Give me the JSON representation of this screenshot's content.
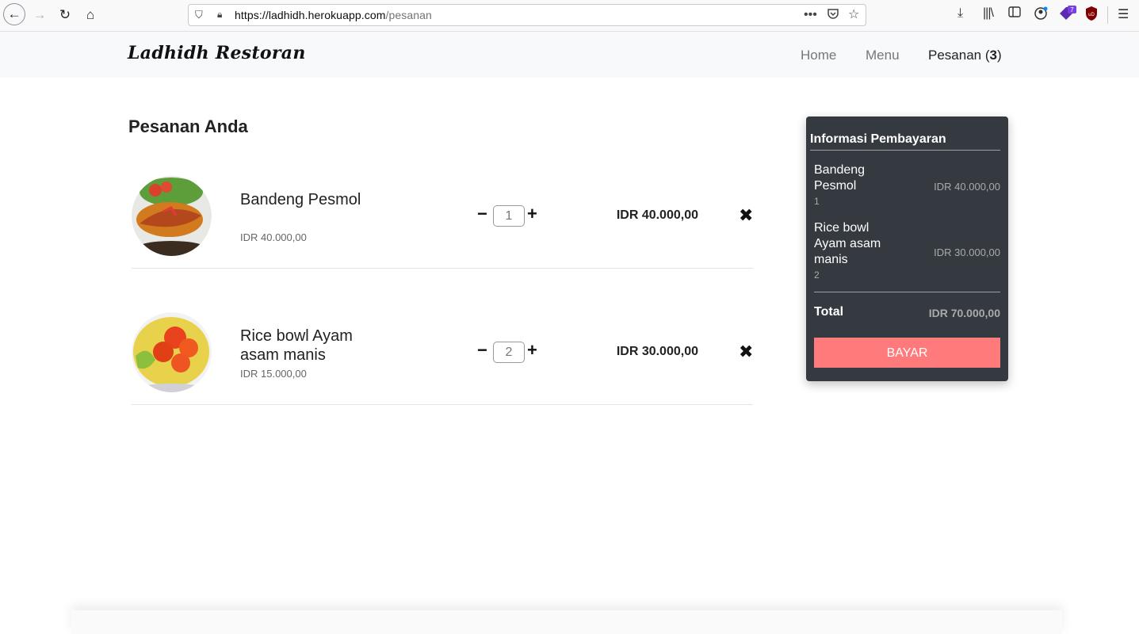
{
  "browser": {
    "url_host": "https://ladhidh.herokuapp.com",
    "url_path": "/pesanan",
    "extension_badge": "7",
    "ublock_label": "uD"
  },
  "navbar": {
    "brand": "Ladhidh Restoran",
    "home": "Home",
    "menu": "Menu",
    "pesanan": "Pesanan (",
    "pesanan_count": "3",
    "pesanan_close": ")"
  },
  "main": {
    "title": "Pesanan Anda",
    "items": [
      {
        "name": "Bandeng Pesmol",
        "price": "IDR 40.000,00",
        "qty": "1",
        "total": "IDR 40.000,00"
      },
      {
        "name": "Rice bowl Ayam asam manis",
        "price": "IDR 15.000,00",
        "qty": "2",
        "total": "IDR 30.000,00"
      }
    ],
    "minus": "−",
    "plus": "+",
    "remove": "✖"
  },
  "payment": {
    "title": "Informasi Pembayaran",
    "rows": [
      {
        "name": "Bandeng Pesmol",
        "qty": "1",
        "amount": "IDR 40.000,00"
      },
      {
        "name": "Rice bowl Ayam asam manis",
        "qty": "2",
        "amount": "IDR 30.000,00"
      }
    ],
    "total_label": "Total",
    "total_amount": "IDR 70.000,00",
    "pay_button": "BAYAR"
  },
  "colors": {
    "panel_bg": "#343a40",
    "pay_button": "#ff7b7b",
    "navbar_bg": "#f8f9fa"
  }
}
